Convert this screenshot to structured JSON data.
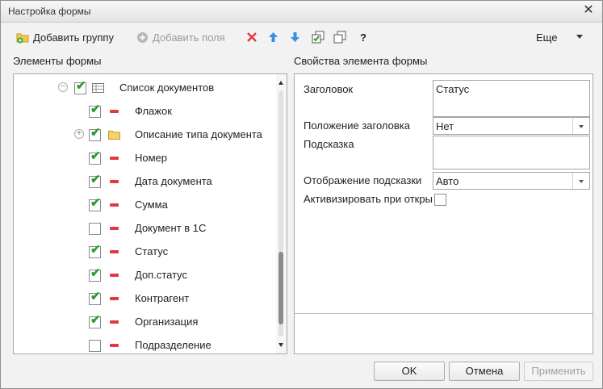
{
  "window": {
    "title": "Настройка формы"
  },
  "toolbar": {
    "add_group": "Добавить группу",
    "add_fields": "Добавить поля",
    "help": "?",
    "more": "Еще",
    "icons": [
      "add-group-icon",
      "add-fields-icon",
      "delete-icon",
      "move-up-icon",
      "move-down-icon",
      "check-all-icon",
      "uncheck-all-icon",
      "help-icon",
      "more-arrow-icon"
    ]
  },
  "left": {
    "title": "Элементы формы",
    "root": {
      "label": "Список документов",
      "checked": true
    },
    "items": [
      {
        "label": "Флажок",
        "checked": true
      },
      {
        "label": "Описание типа документа",
        "checked": true
      },
      {
        "label": "Номер",
        "checked": true
      },
      {
        "label": "Дата документа",
        "checked": true
      },
      {
        "label": "Сумма",
        "checked": true
      },
      {
        "label": "Документ в 1С",
        "checked": false
      },
      {
        "label": "Статус",
        "checked": true
      },
      {
        "label": "Доп.статус",
        "checked": true
      },
      {
        "label": "Контрагент",
        "checked": true
      },
      {
        "label": "Организация",
        "checked": true
      },
      {
        "label": "Подразделение",
        "checked": false
      }
    ]
  },
  "right": {
    "title": "Свойства элемента формы",
    "header_label": "Заголовок",
    "header_value": "Статус",
    "header_pos_label": "Положение заголовка",
    "header_pos_value": "Нет",
    "hint_label": "Подсказка",
    "hint_value": "",
    "hint_display_label": "Отображение подсказки",
    "hint_display_value": "Авто",
    "activate_label": "Активизировать при откры"
  },
  "buttons": {
    "ok": "OK",
    "cancel": "Отмена",
    "apply": "Применить"
  },
  "colors": {
    "check": "#2c9a2c",
    "delete": "#e0393e",
    "arrow": "#3a8ee6"
  }
}
